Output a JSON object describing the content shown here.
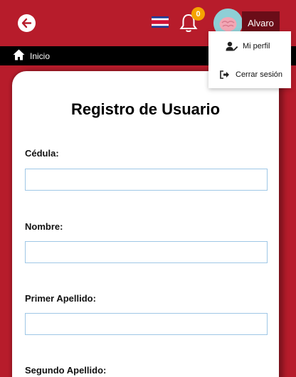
{
  "header": {
    "user_name": "Alvaro",
    "notification_count": "0"
  },
  "breadcrumb": {
    "home_label": "Inicio"
  },
  "user_menu": {
    "items": [
      {
        "label": "Mi perfil",
        "icon": "user-edit-icon"
      },
      {
        "label": "Cerrar sesión",
        "icon": "sign-out-icon"
      }
    ]
  },
  "form": {
    "title": "Registro de Usuario",
    "fields": [
      {
        "label": "Cédula:",
        "value": ""
      },
      {
        "label": "Nombre:",
        "value": ""
      },
      {
        "label": "Primer Apellido:",
        "value": ""
      },
      {
        "label": "Segundo Apellido:",
        "value": ""
      }
    ]
  },
  "colors": {
    "header_bg": "#b71c2b",
    "user_button_bg": "#6b0d18",
    "badge_bg": "#f5a300",
    "field_border": "#9fc7e6"
  }
}
